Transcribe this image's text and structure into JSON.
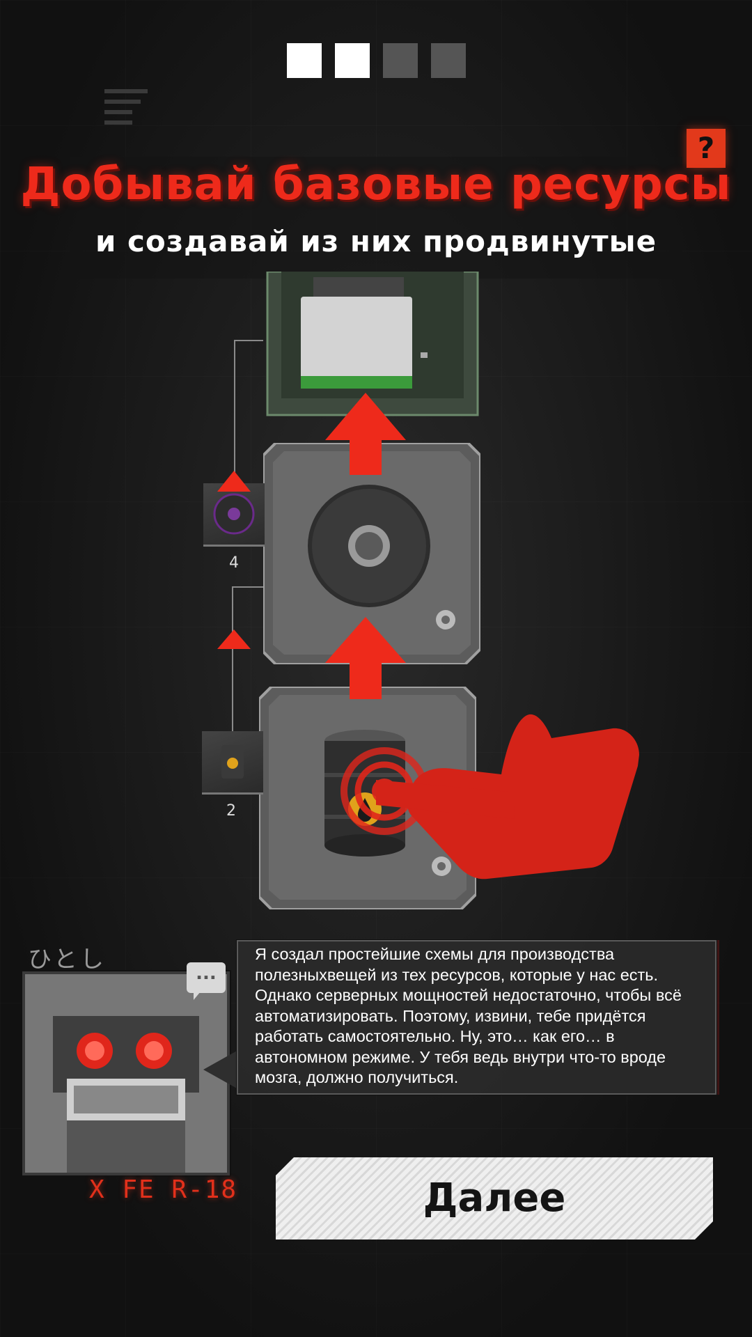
{
  "pager": {
    "total": 4,
    "current": [
      1,
      2
    ]
  },
  "title": "Добывай базовые ресурсы",
  "subtitle": "и создавай из них продвинутые",
  "help_button": {
    "label": "?"
  },
  "production": {
    "nodes": [
      {
        "name": "chip-board",
        "icon": "chip-icon"
      },
      {
        "name": "disc",
        "icon": "disc-icon"
      },
      {
        "name": "oil-barrel",
        "icon": "oil-barrel-icon"
      }
    ],
    "inputs": [
      {
        "icon": "disc-icon",
        "count": "4"
      },
      {
        "icon": "oil-barrel-icon",
        "count": "2"
      }
    ]
  },
  "dialog": {
    "speaker_jp": "ひとし",
    "character_name": "X FE R-18",
    "chat_icon": "...",
    "text": "Я создал простейшие схемы для производства полезныхвещей из тех ресурсов, которые у нас есть. Однако серверных мощностей недостаточно, чтобы всё автоматизировать. Поэтому, извини, тебе придётся работать самостоятельно. Ну, это… как его… в автономном режиме. У тебя ведь внутри что-то вроде мозга, должно получиться."
  },
  "next_button": {
    "label": "Далее"
  },
  "colors": {
    "accent": "#ee2a1b",
    "background": "#1f1f1f",
    "button": "#efefef"
  }
}
